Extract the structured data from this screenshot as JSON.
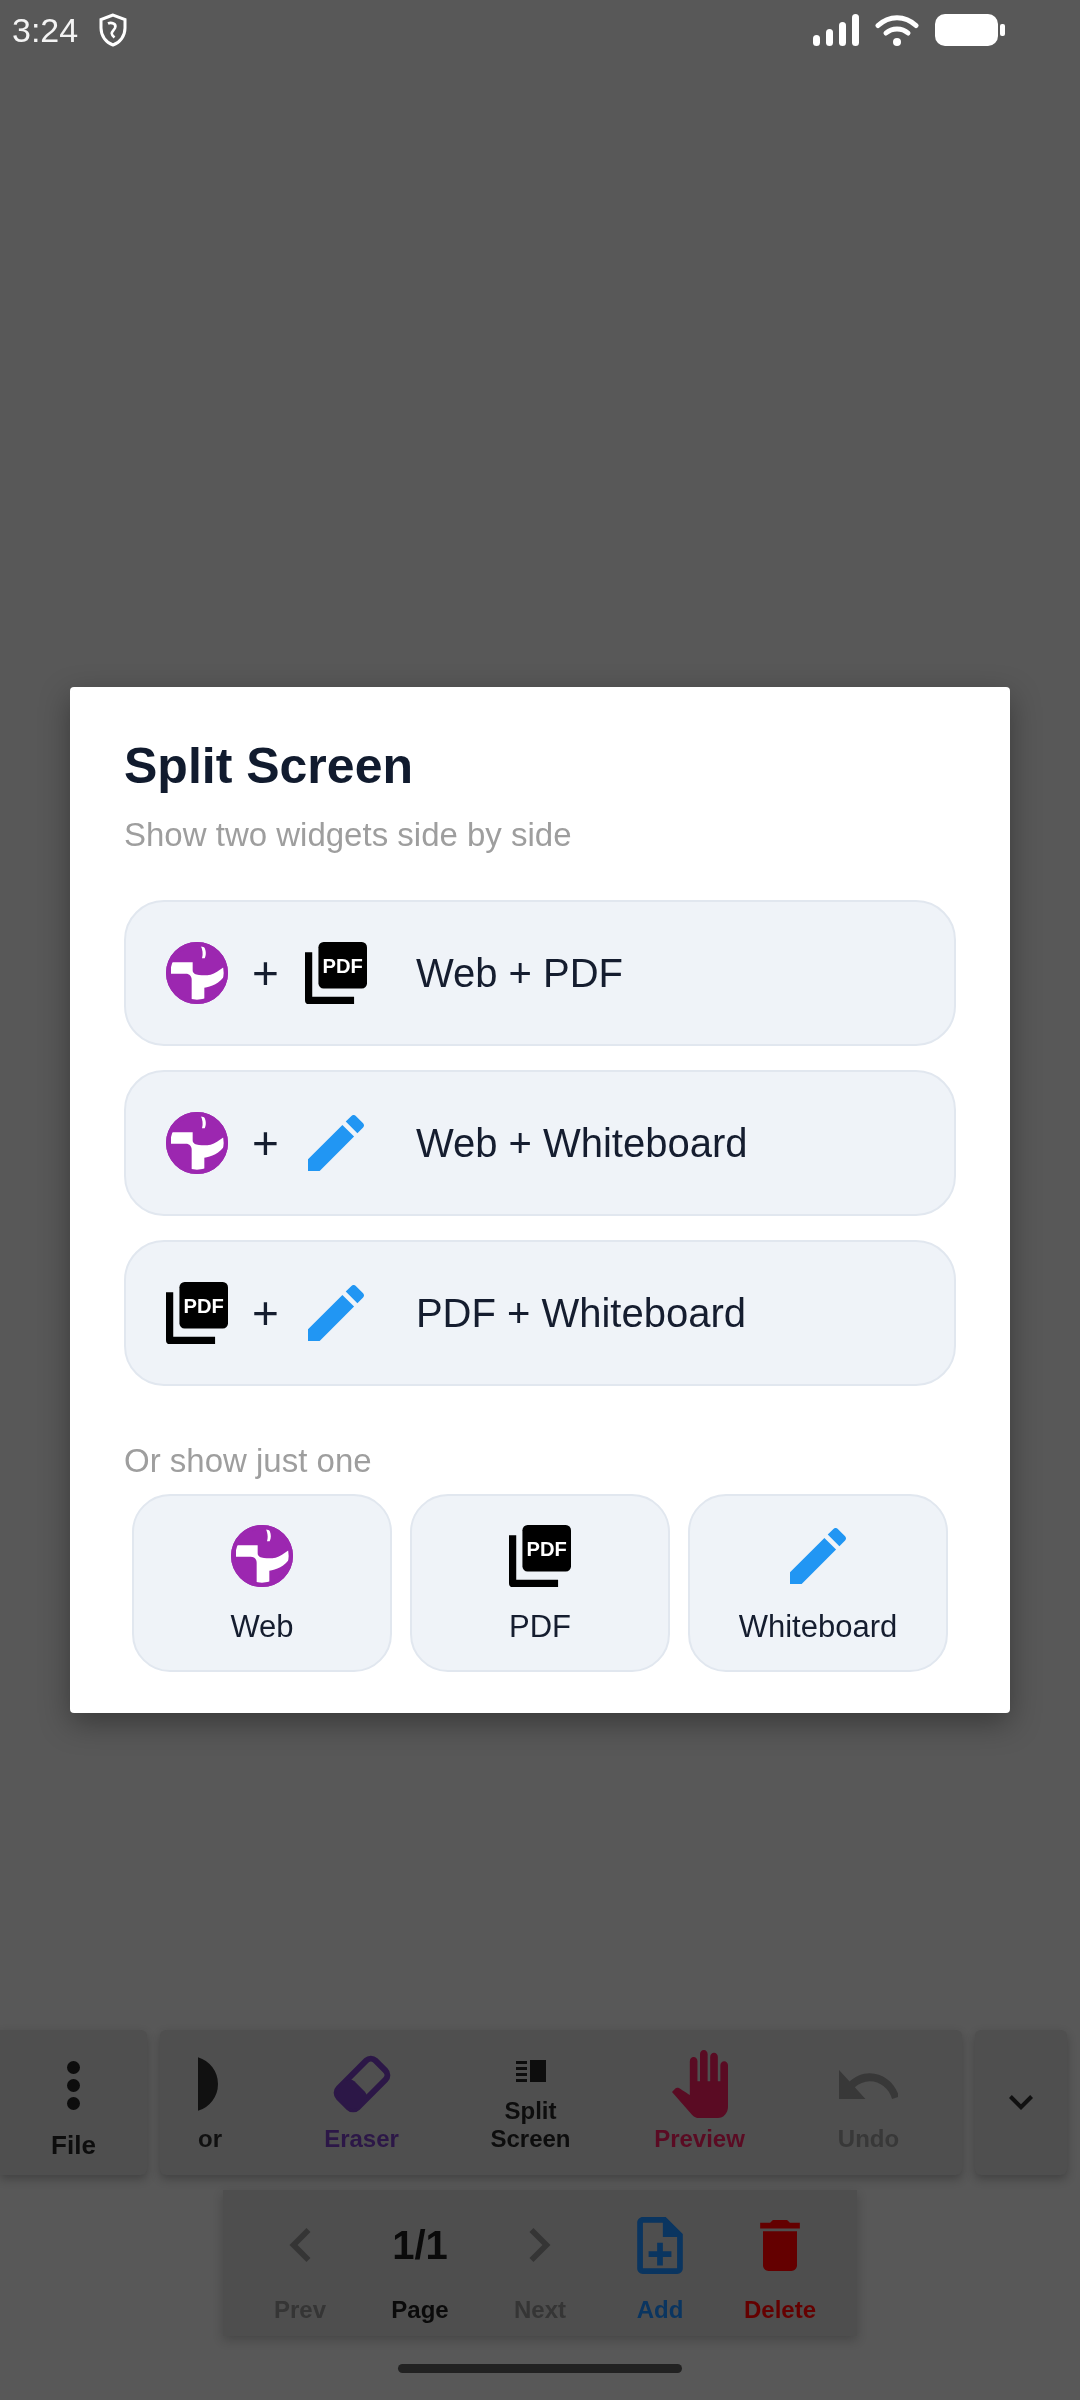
{
  "status_bar": {
    "time": "3:24"
  },
  "dialog": {
    "title": "Split Screen",
    "subtitle": "Show two widgets side by side",
    "pairs": [
      {
        "icons": [
          {
            "kind": "web"
          },
          {
            "kind": "pdf",
            "text": "PDF"
          }
        ],
        "joiner": "+",
        "label": "Web + PDF"
      },
      {
        "icons": [
          {
            "kind": "web"
          },
          {
            "kind": "pen"
          }
        ],
        "joiner": "+",
        "label": "Web + Whiteboard"
      },
      {
        "icons": [
          {
            "kind": "pdf",
            "text": "PDF"
          },
          {
            "kind": "pen"
          }
        ],
        "joiner": "+",
        "label": "PDF + Whiteboard"
      }
    ],
    "singles_heading": "Or show just one",
    "singles": [
      {
        "icon": {
          "kind": "web"
        },
        "label": "Web"
      },
      {
        "icon": {
          "kind": "pdf",
          "text": "PDF"
        },
        "label": "PDF"
      },
      {
        "icon": {
          "kind": "pen"
        },
        "label": "Whiteboard"
      }
    ]
  },
  "toolbar": {
    "menu": {
      "label": "File"
    },
    "tools": [
      {
        "kind": "contrast",
        "label": "or",
        "color": "#111111"
      },
      {
        "kind": "eraser",
        "label": "Eraser",
        "color": "#2c1747"
      },
      {
        "kind": "split",
        "label": "Split Screen",
        "color": "#0d0d0d"
      },
      {
        "kind": "hand",
        "label": "Preview",
        "color": "#5a0b23"
      },
      {
        "kind": "undo",
        "label": "Undo",
        "color": "#383838"
      }
    ]
  },
  "page_nav": [
    {
      "kind": "prev",
      "label": "Prev",
      "color": "#353535"
    },
    {
      "kind": "page",
      "value": "1/1",
      "label": "Page",
      "color": "#0a0a0a"
    },
    {
      "kind": "next",
      "label": "Next",
      "color": "#353535"
    },
    {
      "kind": "add",
      "label": "Add",
      "color": "#0a3560"
    },
    {
      "kind": "delete",
      "label": "Delete",
      "color": "#640000"
    }
  ]
}
